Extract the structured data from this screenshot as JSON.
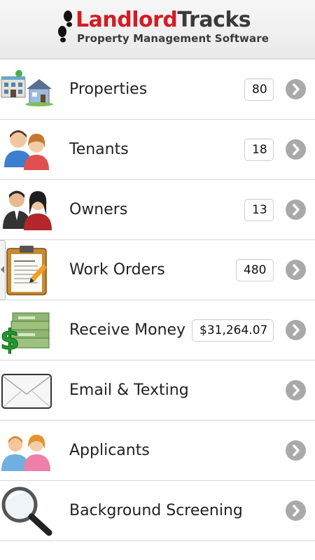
{
  "header": {
    "logo_red": "Landlord",
    "logo_dark": "Tracks",
    "tagline": "Property Management Software"
  },
  "menu": {
    "items": [
      {
        "label": "Properties",
        "badge": "80",
        "icon": "buildings-icon"
      },
      {
        "label": "Tenants",
        "badge": "18",
        "icon": "tenants-people-icon"
      },
      {
        "label": "Owners",
        "badge": "13",
        "icon": "owners-people-icon"
      },
      {
        "label": "Work Orders",
        "badge": "480",
        "icon": "clipboard-icon"
      },
      {
        "label": "Receive Money",
        "badge": "$31,264.07",
        "icon": "money-icon"
      },
      {
        "label": "Email & Texting",
        "badge": "",
        "icon": "envelope-icon"
      },
      {
        "label": "Applicants",
        "badge": "",
        "icon": "applicants-people-icon"
      },
      {
        "label": "Background Screening",
        "badge": "",
        "icon": "magnifier-icon"
      }
    ]
  },
  "colors": {
    "brand_red": "#d31c23",
    "brand_dark": "#3a3a3a",
    "chevron": "#a9a9a9"
  }
}
